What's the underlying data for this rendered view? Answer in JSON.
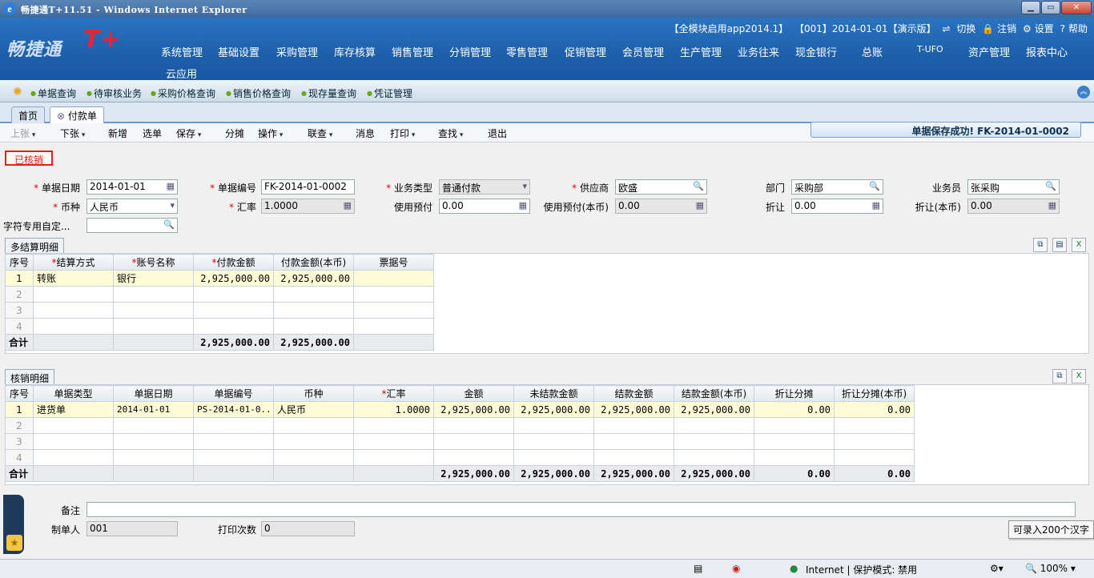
{
  "window": {
    "title": "畅捷通T+11.51 - Windows Internet Explorer"
  },
  "app": {
    "logo": "畅捷通",
    "logo_mark": "T+"
  },
  "top_info": {
    "app": "【全模块启用app2014.1】",
    "account": "【001】2014-01-01【演示版】",
    "switch": "切换",
    "logout": "注销",
    "settings": "设置",
    "help": "帮助"
  },
  "main_menu": [
    "系统管理",
    "基础设置",
    "采购管理",
    "库存核算",
    "销售管理",
    "分销管理",
    "零售管理",
    "促销管理",
    "会员管理",
    "生产管理",
    "业务往来",
    "现金银行",
    "总账",
    "T-UFO",
    "资产管理",
    "报表中心",
    "云应用"
  ],
  "quick_links": [
    "单据查询",
    "待审核业务",
    "采购价格查询",
    "销售价格查询",
    "现存量查询",
    "凭证管理"
  ],
  "tabs": {
    "home": "首页",
    "active": "付款单"
  },
  "toolbar": [
    "上张",
    "下张",
    "新增",
    "选单",
    "保存",
    "分摊",
    "操作",
    "联查",
    "消息",
    "打印",
    "查找",
    "退出"
  ],
  "save_message": "单据保存成功! FK-2014-01-0002",
  "status_stamp": "已核销",
  "form": {
    "date_label": "单据日期",
    "date": "2014-01-01",
    "number_label": "单据编号",
    "number": "FK-2014-01-0002",
    "biz_type_label": "业务类型",
    "biz_type": "普通付款",
    "supplier_label": "供应商",
    "supplier": "欧盛",
    "dept_label": "部门",
    "dept": "采购部",
    "salesman_label": "业务员",
    "salesman": "张采购",
    "currency_label": "币种",
    "currency": "人民币",
    "rate_label": "汇率",
    "rate": "1.0000",
    "prepay_label": "使用预付",
    "prepay": "0.00",
    "prepay_local_label": "使用预付(本币)",
    "prepay_local": "0.00",
    "discount_label": "折让",
    "discount": "0.00",
    "discount_local_label": "折让(本币)",
    "discount_local": "0.00",
    "custom_label": "字符专用自定...",
    "custom": ""
  },
  "settle": {
    "section": "多结算明细",
    "headers": [
      "序号",
      "*结算方式",
      "*账号名称",
      "*付款金额",
      "付款金额(本币)",
      "票据号"
    ],
    "rows": [
      [
        "1",
        "转账",
        "银行",
        "2,925,000.00",
        "2,925,000.00",
        ""
      ],
      [
        "2",
        "",
        "",
        "",
        "",
        ""
      ],
      [
        "3",
        "",
        "",
        "",
        "",
        ""
      ],
      [
        "4",
        "",
        "",
        "",
        "",
        ""
      ]
    ],
    "total": [
      "合计",
      "",
      "",
      "2,925,000.00",
      "2,925,000.00",
      ""
    ]
  },
  "writeoff": {
    "section": "核销明细",
    "headers": [
      "序号",
      "单据类型",
      "单据日期",
      "单据编号",
      "币种",
      "*汇率",
      "金额",
      "未结款金额",
      "结款金额",
      "结款金额(本币)",
      "折让分摊",
      "折让分摊(本币)"
    ],
    "rows": [
      [
        "1",
        "进货单",
        "2014-01-01",
        "PS-2014-01-0...",
        "人民币",
        "1.0000",
        "2,925,000.00",
        "2,925,000.00",
        "2,925,000.00",
        "2,925,000.00",
        "0.00",
        "0.00"
      ],
      [
        "2",
        "",
        "",
        "",
        "",
        "",
        "",
        "",
        "",
        "",
        "",
        ""
      ],
      [
        "3",
        "",
        "",
        "",
        "",
        "",
        "",
        "",
        "",
        "",
        "",
        ""
      ],
      [
        "4",
        "",
        "",
        "",
        "",
        "",
        "",
        "",
        "",
        "",
        "",
        ""
      ]
    ],
    "total": [
      "合计",
      "",
      "",
      "",
      "",
      "",
      "2,925,000.00",
      "2,925,000.00",
      "2,925,000.00",
      "2,925,000.00",
      "0.00",
      "0.00"
    ]
  },
  "footer": {
    "remark_label": "备注",
    "remark": "",
    "maker_label": "制单人",
    "maker": "001",
    "print_label": "打印次数",
    "print_count": "0",
    "hint": "可录入200个汉字"
  },
  "statusbar": {
    "zone": "Internet | 保护模式: 禁用",
    "zoom": "100%"
  }
}
